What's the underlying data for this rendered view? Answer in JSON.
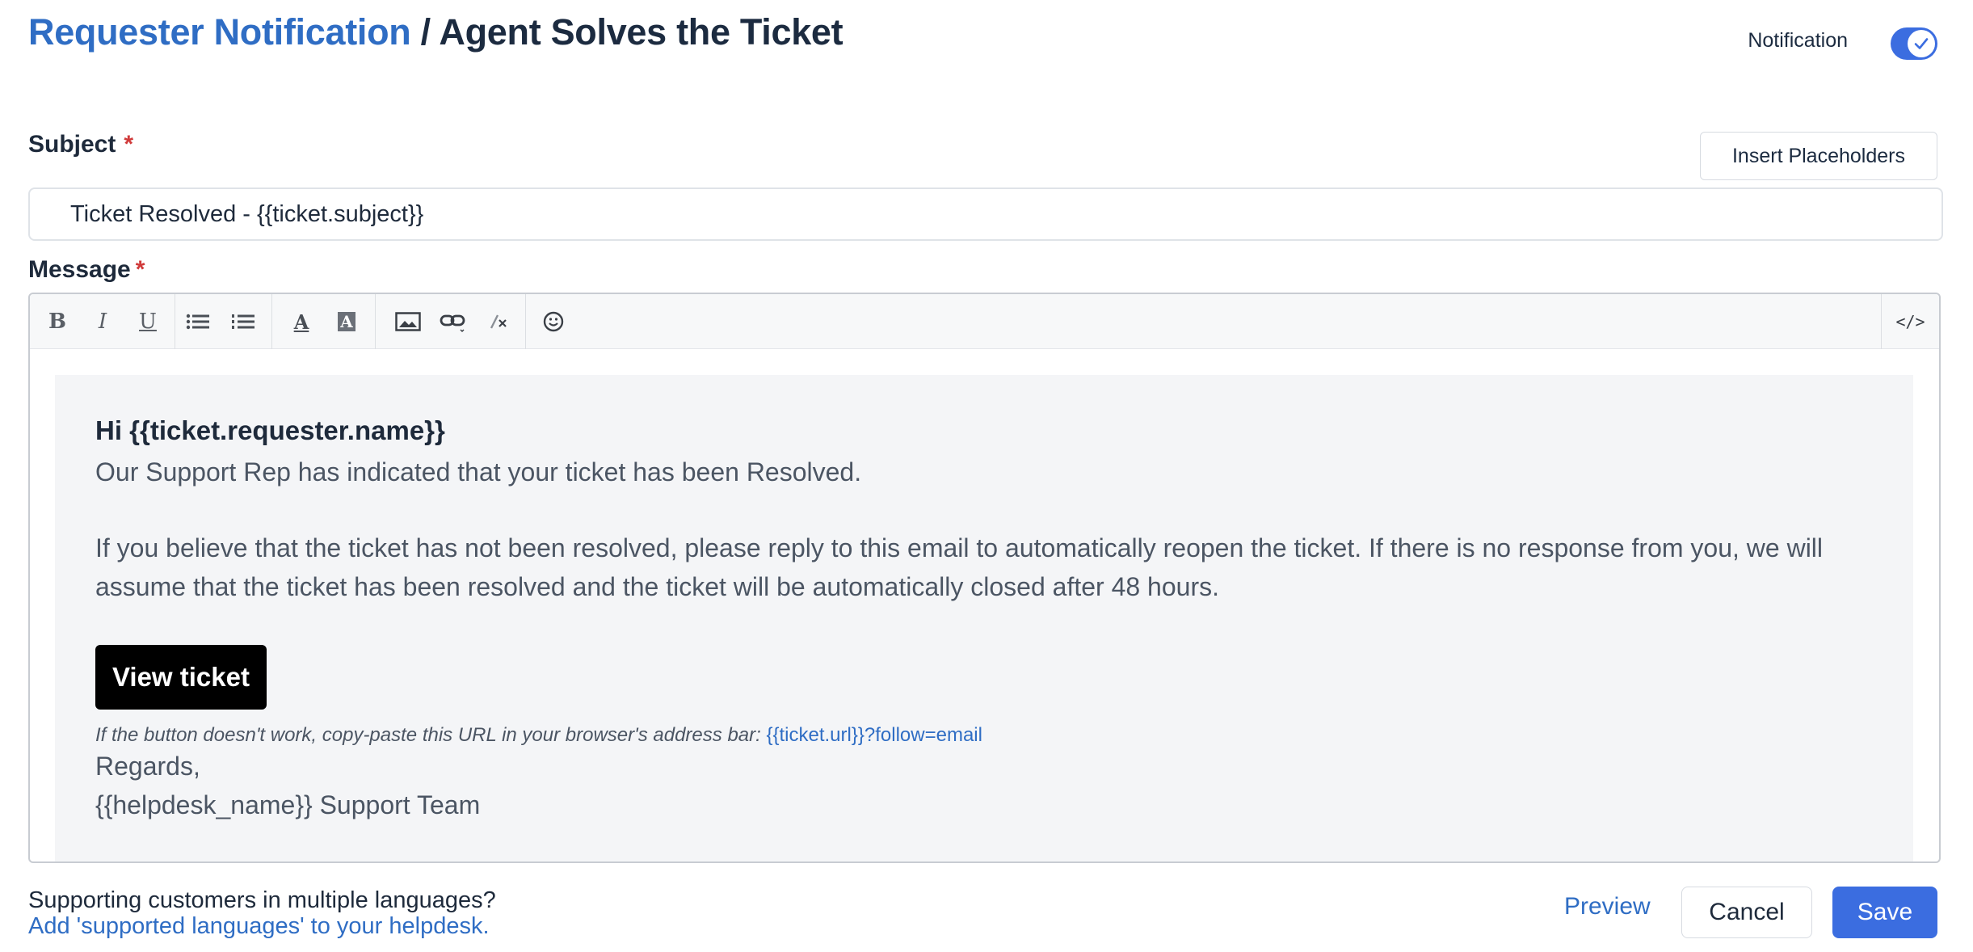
{
  "header": {
    "breadcrumb": "Requester Notification",
    "separator": " / ",
    "title": "Agent Solves the Ticket",
    "notification_label": "Notification",
    "notification_enabled": true
  },
  "subject": {
    "label": "Subject",
    "required_mark": "*",
    "value": "Ticket Resolved - {{ticket.subject}}",
    "insert_placeholders_label": "Insert Placeholders"
  },
  "message": {
    "label": "Message",
    "required_mark": "*",
    "toolbar": {
      "bold": "B",
      "italic": "I",
      "underline": "U",
      "font_color": "A",
      "bg_color": "A",
      "code": "</>"
    },
    "body": {
      "greeting": "Hi {{ticket.requester.name}}",
      "line1": "Our Support Rep has indicated that your ticket has been Resolved.",
      "paragraph2": "If you believe that the ticket has not been resolved, please reply to this email to automatically reopen the ticket. If there is no response from you, we will assume that the ticket has been resolved and the ticket will be automatically closed after 48 hours.",
      "button_label": "View ticket",
      "url_hint": "If the button doesn't work, copy-paste this URL in your browser's address bar: ",
      "url": "{{ticket.url}}?follow=email",
      "regards": "Regards,",
      "signature": "{{helpdesk_name}} Support Team"
    }
  },
  "footer": {
    "question": "Supporting customers in multiple languages?",
    "link": "Add 'supported languages' to your helpdesk.",
    "preview": "Preview",
    "cancel": "Cancel",
    "save": "Save"
  },
  "colors": {
    "accent": "#3b6de0",
    "link": "#2f6dc4",
    "required": "#d03a3a",
    "title": "#1c2b40"
  }
}
